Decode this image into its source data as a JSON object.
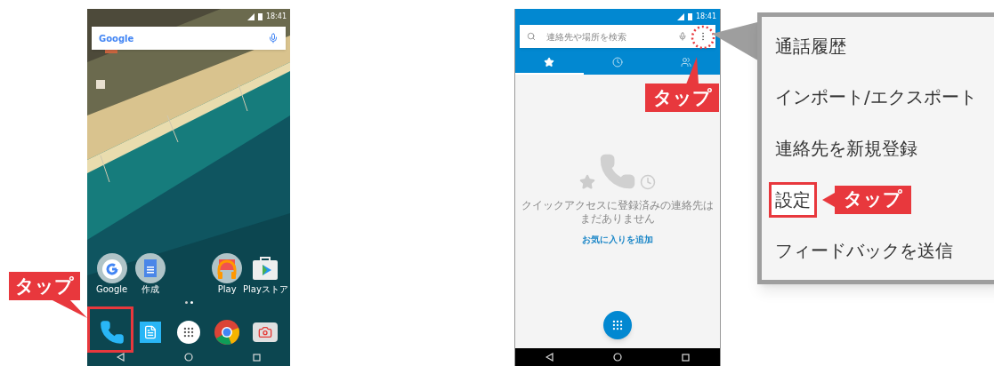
{
  "home_screen": {
    "status_time": "18:41",
    "search_logo": "Google",
    "apps": [
      {
        "kind": "google",
        "label": "Google"
      },
      {
        "kind": "docs",
        "label": "作成"
      },
      {
        "kind": "play",
        "label": "Play"
      },
      {
        "kind": "store",
        "label": "Playストア"
      }
    ],
    "callout": "タップ"
  },
  "phone_app": {
    "status_time": "18:41",
    "search": {
      "placeholder": "連絡先や場所を検索"
    },
    "tabs": [
      {
        "kind": "favorites",
        "selected": true
      },
      {
        "kind": "recent",
        "selected": false
      },
      {
        "kind": "contacts",
        "selected": false
      }
    ],
    "empty_message": "クイックアクセスに登録済みの連絡先はまだありません",
    "add_link": "お気に入りを追加",
    "callout": "タップ"
  },
  "menu": {
    "items": [
      {
        "label": "通話履歴",
        "highlighted": false
      },
      {
        "label": "インポート/エクスポート",
        "highlighted": false
      },
      {
        "label": "連絡先を新規登録",
        "highlighted": false
      },
      {
        "label": "設定",
        "highlighted": true
      },
      {
        "label": "フィードバックを送信",
        "highlighted": false
      }
    ],
    "callout": "タップ"
  }
}
